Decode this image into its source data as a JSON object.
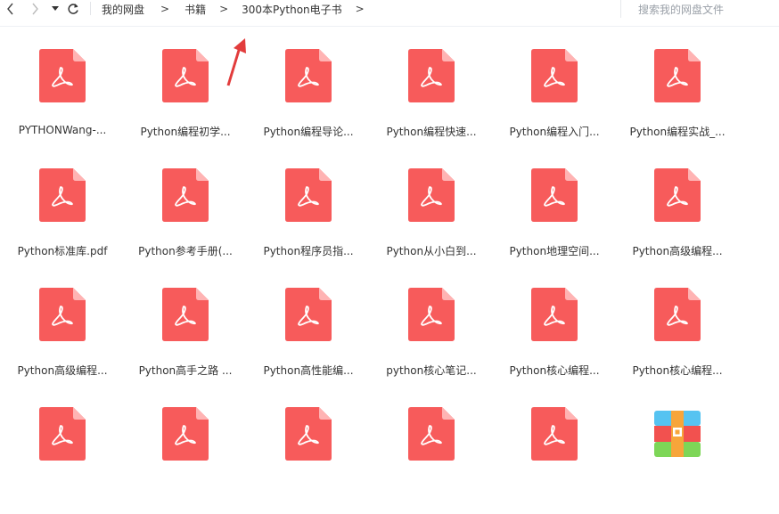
{
  "breadcrumb": [
    "我的网盘",
    "书籍",
    "300本Python电子书"
  ],
  "search": {
    "placeholder": "搜索我的网盘文件"
  },
  "colors": {
    "pdf": "#f75b5b",
    "pdf_fold": "#ffb3b3"
  },
  "files": [
    {
      "name": "PYTHONWang-...",
      "type": "pdf"
    },
    {
      "name": "Python编程初学...",
      "type": "pdf"
    },
    {
      "name": "Python编程导论...",
      "type": "pdf"
    },
    {
      "name": "Python编程快速...",
      "type": "pdf"
    },
    {
      "name": "Python编程入门...",
      "type": "pdf"
    },
    {
      "name": "Python编程实战_...",
      "type": "pdf"
    },
    {
      "name": "Python标准库.pdf",
      "type": "pdf"
    },
    {
      "name": "Python参考手册(...",
      "type": "pdf"
    },
    {
      "name": "Python程序员指...",
      "type": "pdf"
    },
    {
      "name": "Python从小白到...",
      "type": "pdf"
    },
    {
      "name": "Python地理空间...",
      "type": "pdf"
    },
    {
      "name": "Python高级编程...",
      "type": "pdf"
    },
    {
      "name": "Python高级编程...",
      "type": "pdf"
    },
    {
      "name": "Python高手之路 ...",
      "type": "pdf"
    },
    {
      "name": "Python高性能编...",
      "type": "pdf"
    },
    {
      "name": "python核心笔记...",
      "type": "pdf"
    },
    {
      "name": "Python核心编程...",
      "type": "pdf"
    },
    {
      "name": "Python核心编程...",
      "type": "pdf"
    },
    {
      "name": "",
      "type": "pdf"
    },
    {
      "name": "",
      "type": "pdf"
    },
    {
      "name": "",
      "type": "pdf"
    },
    {
      "name": "",
      "type": "pdf"
    },
    {
      "name": "",
      "type": "pdf"
    },
    {
      "name": "",
      "type": "archive"
    }
  ]
}
